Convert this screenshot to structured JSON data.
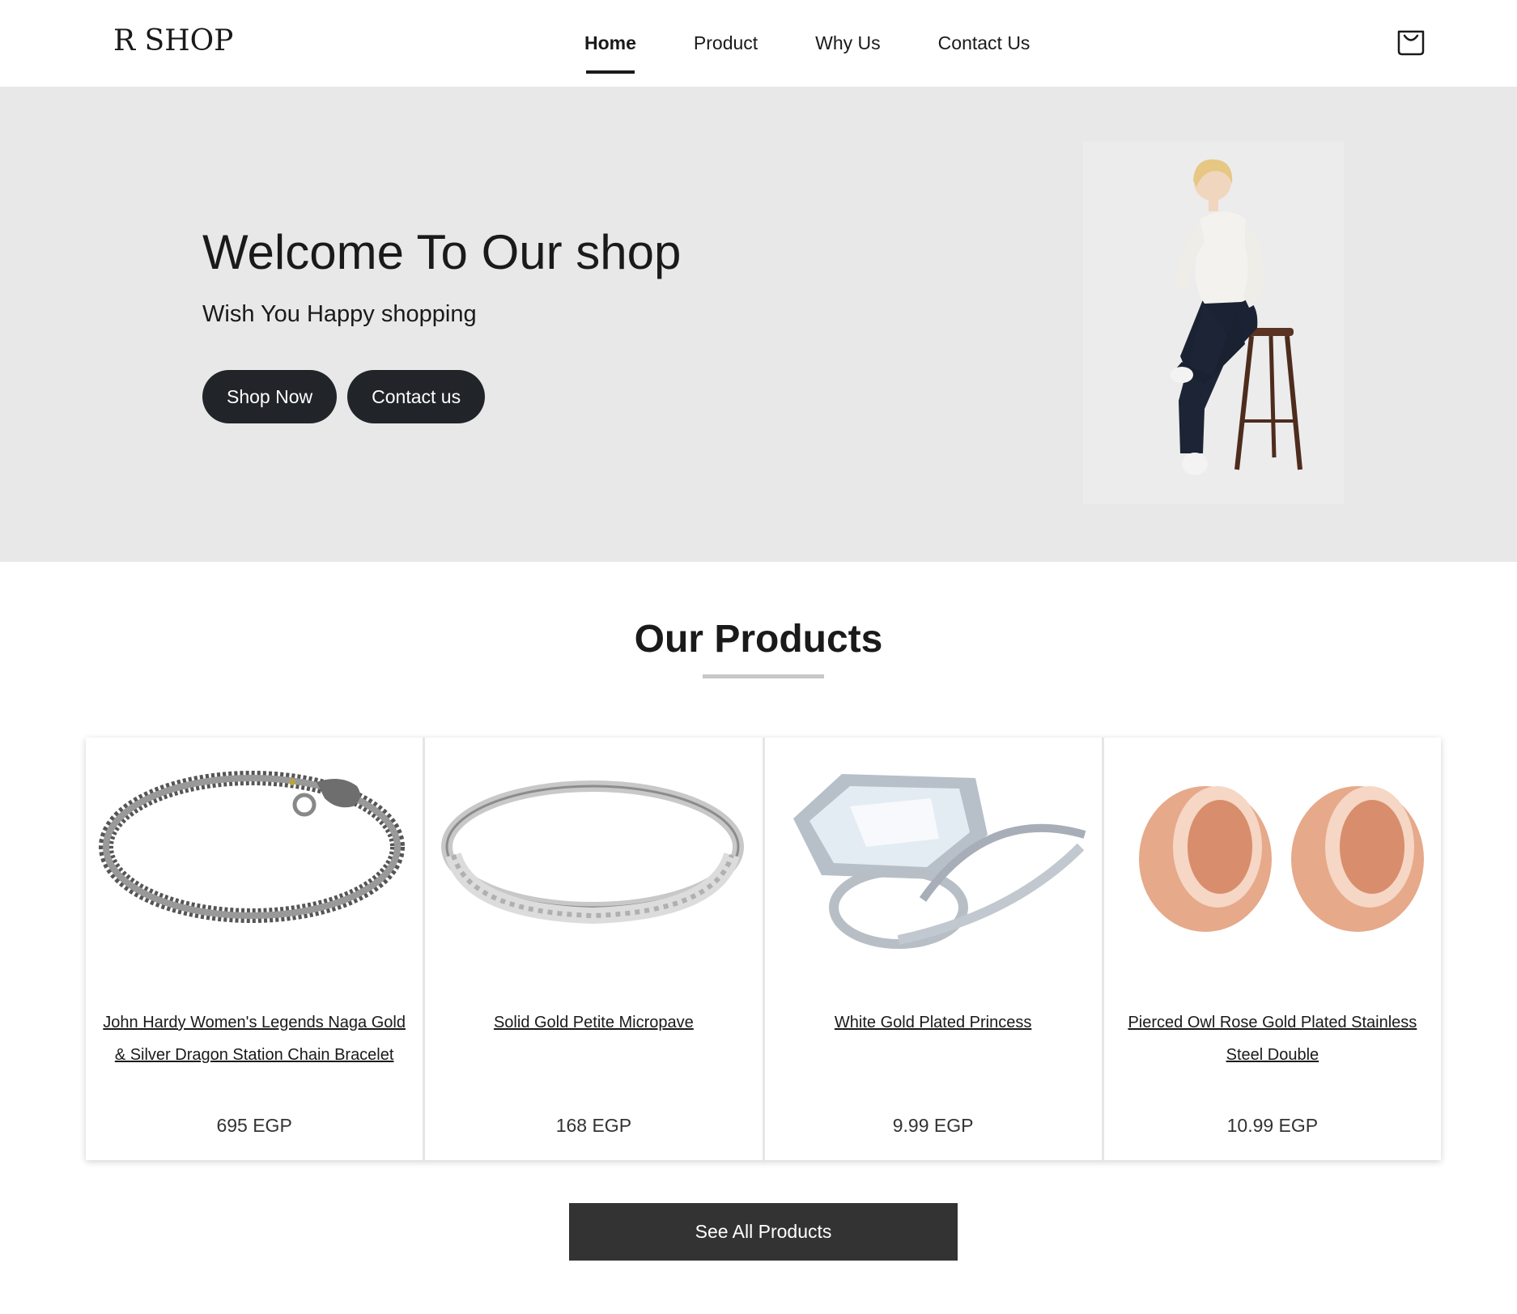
{
  "brand": {
    "logo": "R SHOP"
  },
  "nav": {
    "items": [
      {
        "label": "Home",
        "active": true
      },
      {
        "label": "Product"
      },
      {
        "label": "Why Us"
      },
      {
        "label": "Contact Us"
      }
    ],
    "cart_icon": "shopping-bag-icon"
  },
  "hero": {
    "title": "Welcome To Our shop",
    "subtitle": "Wish You Happy shopping",
    "shop_now": "Shop Now",
    "contact": "Contact us",
    "image": "model-sitting-on-stool-photo"
  },
  "products": {
    "heading": "Our Products",
    "items": [
      {
        "name": "John Hardy Women's Legends Naga Gold & Silver Dragon Station Chain Bracelet",
        "price": "695 EGP",
        "image": "dragon-chain-bracelet"
      },
      {
        "name": "Solid Gold Petite Micropave",
        "price": "168 EGP",
        "image": "silver-band-ring"
      },
      {
        "name": "White Gold Plated Princess",
        "price": "9.99 EGP",
        "image": "princess-cut-ring-set"
      },
      {
        "name": "Pierced Owl Rose Gold Plated Stainless Steel Double",
        "price": "10.99 EGP",
        "image": "rose-gold-tunnel-plugs"
      }
    ],
    "see_all": "See All Products"
  },
  "colors": {
    "dark_button": "#212529",
    "see_all_button": "#333333",
    "hero_bg": "#e8e8e8"
  }
}
